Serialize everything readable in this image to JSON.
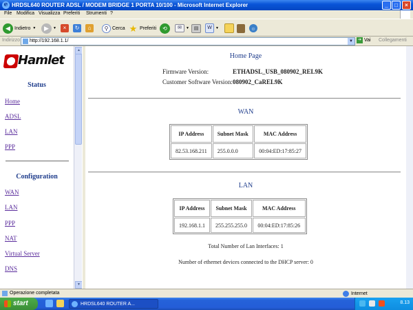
{
  "window": {
    "title": "HRDSL640 ROUTER ADSL / MODEM BRIDGE 1 PORTA 10/100 - Microsoft Internet Explorer",
    "controls": [
      "_",
      "□",
      "×"
    ]
  },
  "menu": [
    "File",
    "Modifica",
    "Visualizza",
    "Preferiti",
    "Strumenti",
    "?"
  ],
  "toolbar": {
    "back_label": "Indietro",
    "search_label": "Cerca",
    "favorites_label": "Preferiti"
  },
  "address": {
    "label": "Indirizzo",
    "url": "http://192.168.1.1/",
    "go_label": "Vai",
    "links_label": "Collegamenti"
  },
  "left": {
    "logo_text": "Hamlet",
    "status_title": "Status",
    "status_links": [
      "Home",
      "ADSL",
      "LAN",
      "PPP"
    ],
    "config_title": "Configuration",
    "config_links": [
      "WAN",
      "LAN",
      "PPP",
      "NAT",
      "Virtual Server",
      "DNS"
    ]
  },
  "main": {
    "title": "Home Page",
    "firmware_label": "Firmware Version:",
    "firmware_value": "ETHADSL_USB_080902_REL9K",
    "customer_label": "Customer Software Version:",
    "customer_value": "080902_CaREL9K",
    "wan": {
      "title": "WAN",
      "headers": [
        "IP Address",
        "Subnet Mask",
        "MAC Address"
      ],
      "row": [
        "82.53.168.211",
        "255.0.0.0",
        "00:04:ED:17:85:27"
      ]
    },
    "lan": {
      "title": "LAN",
      "headers": [
        "IP Address",
        "Subnet Mask",
        "MAC Address"
      ],
      "row": [
        "192.168.1.1",
        "255.255.255.0",
        "00:04:ED:17:85:26"
      ]
    },
    "lan_interfaces": "Total Number of Lan Interfaces: 1",
    "dhcp_devices": "Number of ethernet devices connected to the DHCP server: 0"
  },
  "status": {
    "text": "Operazione completata",
    "zone": "Internet"
  },
  "taskbar": {
    "start_label": "start",
    "task_label": "HRDSL640 ROUTER A...",
    "clock": "8.13"
  },
  "colors": {
    "title_blue": "#0a55d8",
    "nav_heading": "#1f3d8c",
    "link_visited": "#5a2c9c",
    "start_green": "#3a8f36"
  }
}
